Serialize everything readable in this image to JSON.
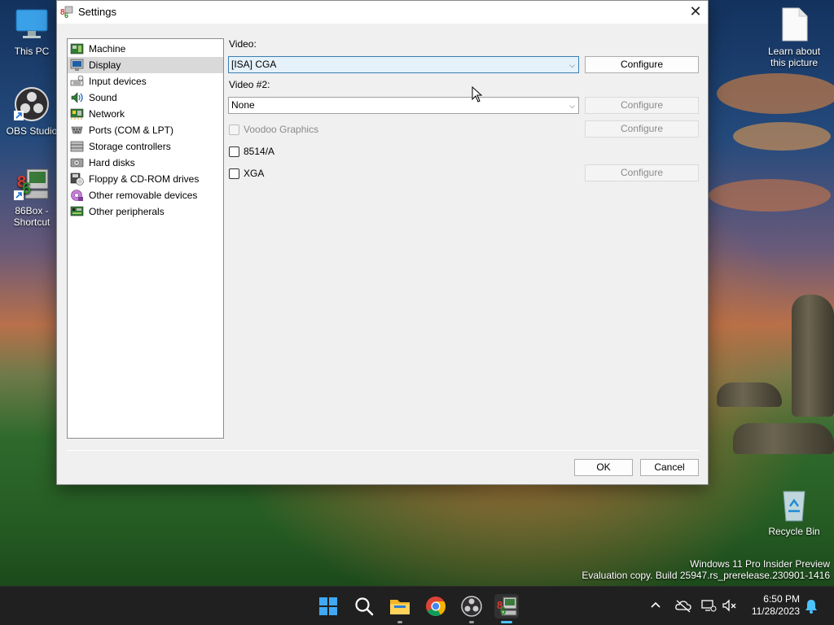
{
  "window": {
    "title": "Settings"
  },
  "sidebar": {
    "items": [
      {
        "label": "Machine",
        "icon": "machine-icon"
      },
      {
        "label": "Display",
        "icon": "display-icon",
        "selected": true
      },
      {
        "label": "Input devices",
        "icon": "input-devices-icon"
      },
      {
        "label": "Sound",
        "icon": "sound-icon"
      },
      {
        "label": "Network",
        "icon": "network-icon"
      },
      {
        "label": "Ports (COM & LPT)",
        "icon": "ports-icon"
      },
      {
        "label": "Storage controllers",
        "icon": "storage-controllers-icon"
      },
      {
        "label": "Hard disks",
        "icon": "hard-disk-icon"
      },
      {
        "label": "Floppy & CD-ROM drives",
        "icon": "floppy-cdrom-icon"
      },
      {
        "label": "Other removable devices",
        "icon": "removable-devices-icon"
      },
      {
        "label": "Other peripherals",
        "icon": "peripherals-icon"
      }
    ]
  },
  "display": {
    "video_label": "Video:",
    "video_value": "[ISA] CGA",
    "video_configure": "Configure",
    "video2_label": "Video #2:",
    "video2_value": "None",
    "video2_configure": "Configure",
    "voodoo_label": "Voodoo Graphics",
    "voodoo_configure": "Configure",
    "ibm8514_label": "8514/A",
    "xga_label": "XGA",
    "xga_configure": "Configure"
  },
  "footer": {
    "ok": "OK",
    "cancel": "Cancel"
  },
  "desktop": {
    "icons": [
      {
        "label": "This PC"
      },
      {
        "label": "OBS Studio"
      },
      {
        "label": "86Box - Shortcut"
      },
      {
        "label": "Learn about this picture"
      },
      {
        "label": "Recycle Bin"
      }
    ],
    "watermark_line1": "Windows 11 Pro Insider Preview",
    "watermark_line2": "Evaluation copy. Build 25947.rs_prerelease.230901-1416"
  },
  "taskbar": {
    "time": "6:50 PM",
    "date": "11/28/2023",
    "accent": "#4cc2ff"
  }
}
